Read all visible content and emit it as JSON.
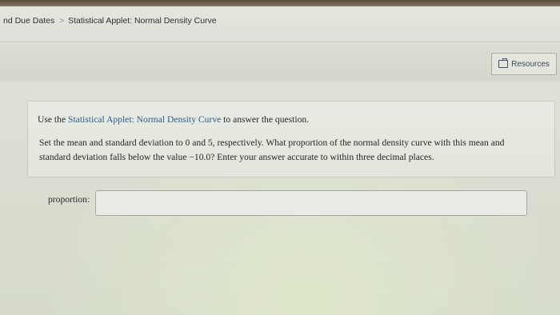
{
  "breadcrumb": {
    "items": [
      "nd Due Dates",
      "Statistical Applet: Normal Density Curve"
    ],
    "separator": ">"
  },
  "resources": {
    "label": "Resources",
    "icon": "book-icon"
  },
  "question": {
    "intro_prefix": "Use the ",
    "intro_link": "Statistical Applet: Normal Density Curve",
    "intro_suffix": " to answer the question.",
    "line1": "Set the mean and standard deviation to 0 and 5, respectively. What proportion of the normal density curve with this mean and",
    "line2": "standard deviation falls below the value −10.0? Enter your answer accurate to within three decimal places."
  },
  "answer": {
    "label": "proportion:",
    "value": "",
    "placeholder": ""
  },
  "colors": {
    "link": "#2e5b8f",
    "background": "#d8dbd2"
  }
}
